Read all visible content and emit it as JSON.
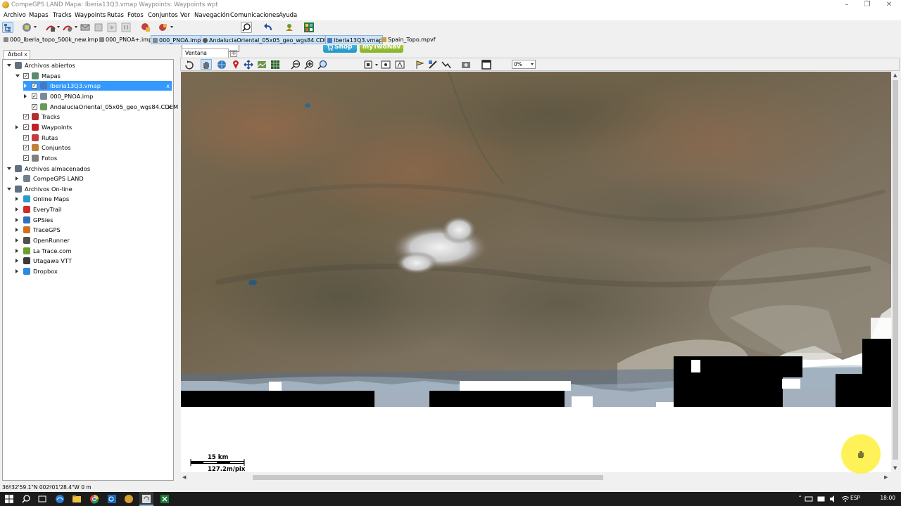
{
  "window": {
    "title": "CompeGPS LAND Mapa: Iberia13Q3.vmap Waypoints: Waypoints.wpt"
  },
  "menu": [
    "Archivo",
    "Mapas",
    "Tracks",
    "Waypoints",
    "Rutas",
    "Fotos",
    "Conjuntos",
    "Ver",
    "Navegación",
    "Comunicaciones",
    "Ayuda"
  ],
  "toolbar": {
    "search_value": "",
    "shop_label": "Shop",
    "mytwonav_label": "myTwoNav"
  },
  "file_tabs": [
    {
      "label": "000_Iberia_topo_500k_new.imp",
      "active": false
    },
    {
      "label": "000_PNOA+.imp",
      "active": false
    },
    {
      "label": "000_PNOA.imp",
      "active": true
    },
    {
      "label": "AndaluciaOriental_05x05_geo_wgs84.CDEM",
      "active": true
    },
    {
      "label": "Iberia13Q3.vmap",
      "active": true
    },
    {
      "label": "Spain_Topo.mpvf",
      "active": false
    }
  ],
  "panel": {
    "tab_label": "Árbol",
    "tab_close": "x"
  },
  "tree": [
    {
      "label": "Archivos abiertos",
      "level": 0,
      "expanded": true,
      "checkbox": false,
      "icon": "globe-icon",
      "color": "#607080"
    },
    {
      "label": "Mapas",
      "level": 1,
      "expanded": true,
      "checkbox": true,
      "icon": "map-icon",
      "color": "#5d8a6a"
    },
    {
      "label": "Iberia13Q3.vmap",
      "level": 2,
      "expanded": false,
      "checkbox": true,
      "icon": "vmap-icon",
      "color": "#4a78c0",
      "selected": true,
      "close": "x"
    },
    {
      "label": "000_PNOA.imp",
      "level": 2,
      "expanded": false,
      "checkbox": true,
      "icon": "raster-icon",
      "color": "#7a8a9a"
    },
    {
      "label": "AndaluciaOriental_05x05_geo_wgs84.CDEM",
      "level": 2,
      "expanded": null,
      "checkbox": true,
      "icon": "dem-icon",
      "color": "#6a9a5a",
      "close": "x"
    },
    {
      "label": "Tracks",
      "level": 1,
      "expanded": null,
      "checkbox": true,
      "icon": "track-icon",
      "color": "#b03030"
    },
    {
      "label": "Waypoints",
      "level": 1,
      "expanded": false,
      "checkbox": true,
      "icon": "waypoint-icon",
      "color": "#c02020"
    },
    {
      "label": "Rutas",
      "level": 1,
      "expanded": null,
      "checkbox": true,
      "icon": "route-icon",
      "color": "#c04040"
    },
    {
      "label": "Conjuntos",
      "level": 1,
      "expanded": null,
      "checkbox": true,
      "icon": "sets-icon",
      "color": "#c0803a"
    },
    {
      "label": "Fotos",
      "level": 1,
      "expanded": null,
      "checkbox": true,
      "icon": "photo-icon",
      "color": "#808080"
    },
    {
      "label": "Archivos almacenados",
      "level": 0,
      "expanded": true,
      "checkbox": false,
      "icon": "storage-icon",
      "color": "#607080"
    },
    {
      "label": "CompeGPS LAND",
      "level": 1,
      "expanded": false,
      "checkbox": false,
      "icon": "folder-icon",
      "color": "#708090"
    },
    {
      "label": "Archivos On-line",
      "level": 0,
      "expanded": true,
      "checkbox": false,
      "icon": "online-icon",
      "color": "#607080"
    },
    {
      "label": "Online Maps",
      "level": 1,
      "expanded": false,
      "checkbox": false,
      "icon": "online-maps-icon",
      "color": "#2a9ad0"
    },
    {
      "label": "EveryTrail",
      "level": 1,
      "expanded": false,
      "checkbox": false,
      "icon": "everytrail-icon",
      "color": "#d02a2a"
    },
    {
      "label": "GPSies",
      "level": 1,
      "expanded": false,
      "checkbox": false,
      "icon": "gpsies-icon",
      "color": "#3070c0"
    },
    {
      "label": "TraceGPS",
      "level": 1,
      "expanded": false,
      "checkbox": false,
      "icon": "tracegps-icon",
      "color": "#d07020"
    },
    {
      "label": "OpenRunner",
      "level": 1,
      "expanded": false,
      "checkbox": false,
      "icon": "openrunner-icon",
      "color": "#505050"
    },
    {
      "label": "La Trace.com",
      "level": 1,
      "expanded": false,
      "checkbox": false,
      "icon": "latrace-icon",
      "color": "#6aa02a"
    },
    {
      "label": "Utagawa VTT",
      "level": 1,
      "expanded": false,
      "checkbox": false,
      "icon": "utagawa-icon",
      "color": "#3a3a3a"
    },
    {
      "label": "Dropbox",
      "level": 1,
      "expanded": false,
      "checkbox": false,
      "icon": "dropbox-icon",
      "color": "#2a8ae0"
    }
  ],
  "map_tabs": {
    "main_label": "Ventana principal",
    "add_label": "+"
  },
  "map_toolbar": {
    "zoom_value": "0%"
  },
  "scale": {
    "distance": "15 km",
    "resolution": "127.2m/pix"
  },
  "status": {
    "coords": "36º32'59.1\"N 002º01'28.4\"W  0 m"
  },
  "taskbar": {
    "language": "ESP",
    "time": "18:00"
  },
  "colors": {
    "accent": "#3399ff",
    "shop": "#1f93c4",
    "mytwonav": "#86b02a"
  }
}
